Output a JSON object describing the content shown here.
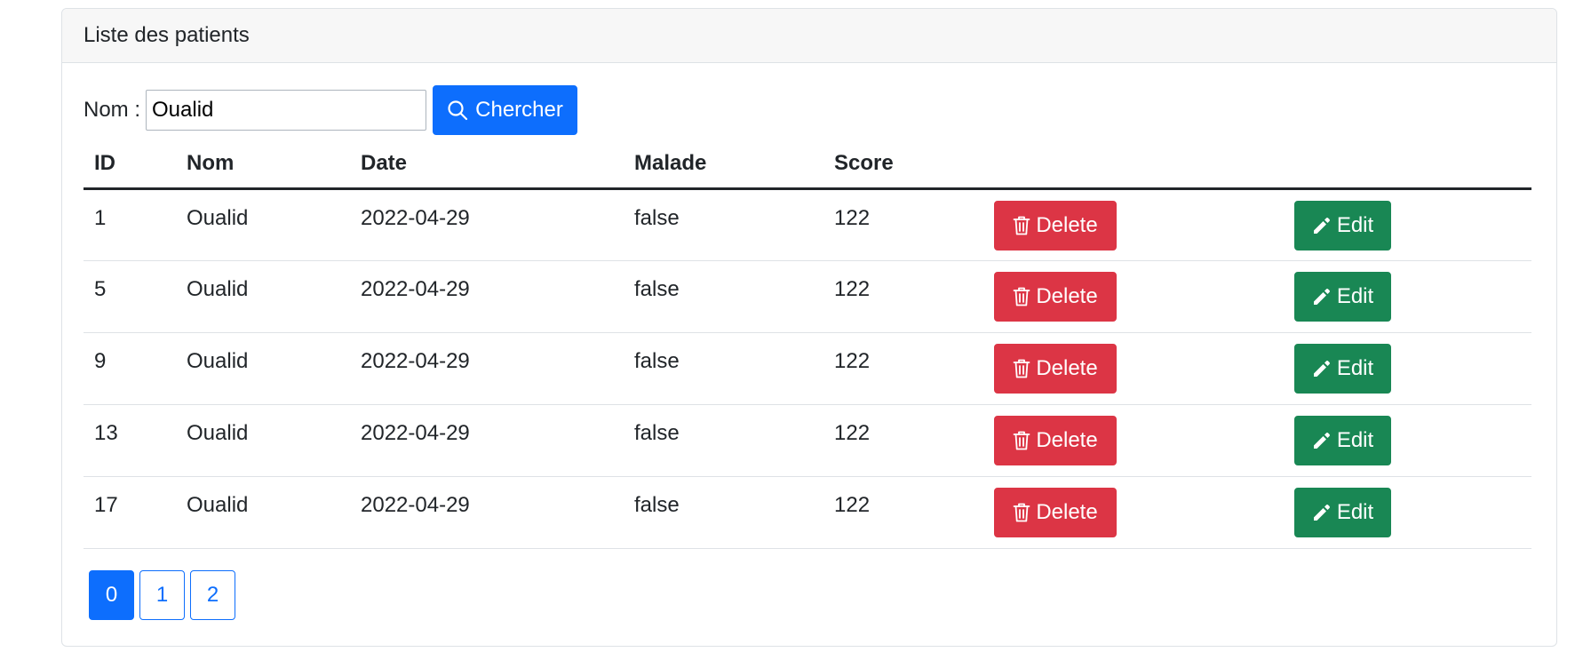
{
  "card": {
    "title": "Liste des patients"
  },
  "search": {
    "label": "Nom :",
    "value": "Oualid",
    "button_label": "Chercher"
  },
  "table": {
    "headers": [
      "ID",
      "Nom",
      "Date",
      "Malade",
      "Score",
      "",
      ""
    ],
    "rows": [
      {
        "id": "1",
        "nom": "Oualid",
        "date": "2022-04-29",
        "malade": "false",
        "score": "122"
      },
      {
        "id": "5",
        "nom": "Oualid",
        "date": "2022-04-29",
        "malade": "false",
        "score": "122"
      },
      {
        "id": "9",
        "nom": "Oualid",
        "date": "2022-04-29",
        "malade": "false",
        "score": "122"
      },
      {
        "id": "13",
        "nom": "Oualid",
        "date": "2022-04-29",
        "malade": "false",
        "score": "122"
      },
      {
        "id": "17",
        "nom": "Oualid",
        "date": "2022-04-29",
        "malade": "false",
        "score": "122"
      }
    ],
    "delete_label": "Delete",
    "edit_label": "Edit"
  },
  "pagination": {
    "pages": [
      "0",
      "1",
      "2"
    ],
    "current": "0"
  },
  "colors": {
    "primary": "#0d6efd",
    "danger": "#dc3545",
    "success": "#198754"
  },
  "icons": {
    "search": "search-icon",
    "delete": "trash-icon",
    "edit": "pencil-icon"
  }
}
